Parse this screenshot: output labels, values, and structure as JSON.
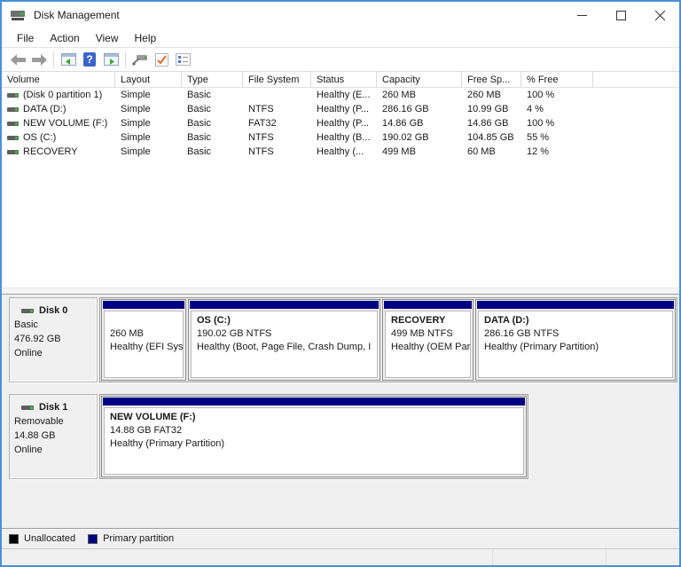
{
  "window": {
    "title": "Disk Management"
  },
  "menu": {
    "items": [
      "File",
      "Action",
      "View",
      "Help"
    ]
  },
  "volume_table": {
    "columns": [
      "Volume",
      "Layout",
      "Type",
      "File System",
      "Status",
      "Capacity",
      "Free Sp...",
      "% Free"
    ],
    "rows": [
      {
        "volume": "(Disk 0 partition 1)",
        "layout": "Simple",
        "type": "Basic",
        "file_system": "",
        "status": "Healthy (E...",
        "capacity": "260 MB",
        "free_space": "260 MB",
        "pct_free": "100 %"
      },
      {
        "volume": "DATA (D:)",
        "layout": "Simple",
        "type": "Basic",
        "file_system": "NTFS",
        "status": "Healthy (P...",
        "capacity": "286.16 GB",
        "free_space": "10.99 GB",
        "pct_free": "4 %"
      },
      {
        "volume": "NEW VOLUME (F:)",
        "layout": "Simple",
        "type": "Basic",
        "file_system": "FAT32",
        "status": "Healthy (P...",
        "capacity": "14.86 GB",
        "free_space": "14.86 GB",
        "pct_free": "100 %"
      },
      {
        "volume": "OS (C:)",
        "layout": "Simple",
        "type": "Basic",
        "file_system": "NTFS",
        "status": "Healthy (B...",
        "capacity": "190.02 GB",
        "free_space": "104.85 GB",
        "pct_free": "55 %"
      },
      {
        "volume": "RECOVERY",
        "layout": "Simple",
        "type": "Basic",
        "file_system": "NTFS",
        "status": "Healthy (...",
        "capacity": "499 MB",
        "free_space": "60 MB",
        "pct_free": "12 %"
      }
    ]
  },
  "graphical_view": {
    "disks": [
      {
        "name": "Disk 0",
        "kind": "Basic",
        "size": "476.92 GB",
        "state": "Online",
        "partitions": [
          {
            "title": "",
            "line2": "260 MB",
            "line3": "Healthy (EFI Syst"
          },
          {
            "title": "OS (C:)",
            "line2": "190.02 GB NTFS",
            "line3": "Healthy (Boot, Page File, Crash Dump, I"
          },
          {
            "title": "RECOVERY",
            "line2": "499 MB NTFS",
            "line3": "Healthy (OEM Part"
          },
          {
            "title": "DATA (D:)",
            "line2": "286.16 GB NTFS",
            "line3": "Healthy (Primary Partition)"
          }
        ]
      },
      {
        "name": "Disk 1",
        "kind": "Removable",
        "size": "14.88 GB",
        "state": "Online",
        "partitions": [
          {
            "title": "NEW VOLUME (F:)",
            "line2": "14.88 GB FAT32",
            "line3": "Healthy (Primary Partition)"
          }
        ]
      }
    ]
  },
  "legend": {
    "items": [
      {
        "label": "Unallocated",
        "color": "#000000"
      },
      {
        "label": "Primary partition",
        "color": "#000082"
      }
    ]
  },
  "colors": {
    "partition_bar": "#000082",
    "window_border": "#4a90d8"
  }
}
